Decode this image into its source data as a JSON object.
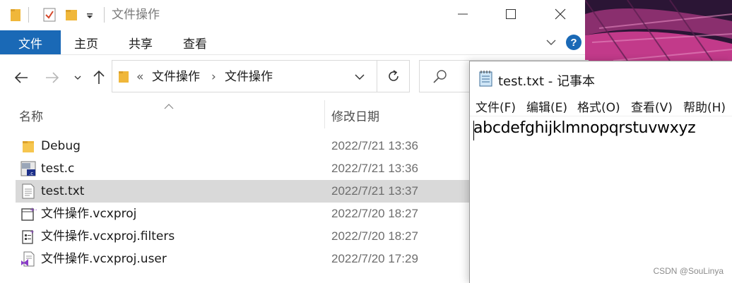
{
  "explorer": {
    "title": "文件操作",
    "window_controls": {
      "minimize": "—",
      "maximize": "☐",
      "close": "✕"
    },
    "ribbon": {
      "tabs": [
        {
          "label": "文件",
          "active": true
        },
        {
          "label": "主页"
        },
        {
          "label": "共享"
        },
        {
          "label": "查看"
        }
      ],
      "help_label": "?"
    },
    "address": {
      "prefix": "«",
      "crumbs": [
        "文件操作",
        "文件操作"
      ],
      "separator": "›"
    },
    "columns": {
      "name": "名称",
      "date": "修改日期"
    },
    "files": [
      {
        "name": "Debug",
        "date": "2022/7/21 13:36",
        "icon": "folder-icon"
      },
      {
        "name": "test.c",
        "date": "2022/7/21 13:36",
        "icon": "c-source-file-icon"
      },
      {
        "name": "test.txt",
        "date": "2022/7/21 13:37",
        "icon": "text-file-icon",
        "selected": true
      },
      {
        "name": "文件操作.vcxproj",
        "date": "2022/7/20 18:27",
        "icon": "vcxproj-file-icon"
      },
      {
        "name": "文件操作.vcxproj.filters",
        "date": "2022/7/20 18:27",
        "icon": "filters-file-icon"
      },
      {
        "name": "文件操作.vcxproj.user",
        "date": "2022/7/20 17:29",
        "icon": "vs-user-file-icon"
      }
    ],
    "accent_color": "#1a69b6",
    "selection_color": "#d9d9d9"
  },
  "notepad": {
    "title": "test.txt - 记事本",
    "menu": [
      "文件(F)",
      "编辑(E)",
      "格式(O)",
      "查看(V)",
      "帮助(H)"
    ],
    "content": "abcdefghijklmnopqrstuvwxyz"
  },
  "watermark": "CSDN @SouLinya"
}
